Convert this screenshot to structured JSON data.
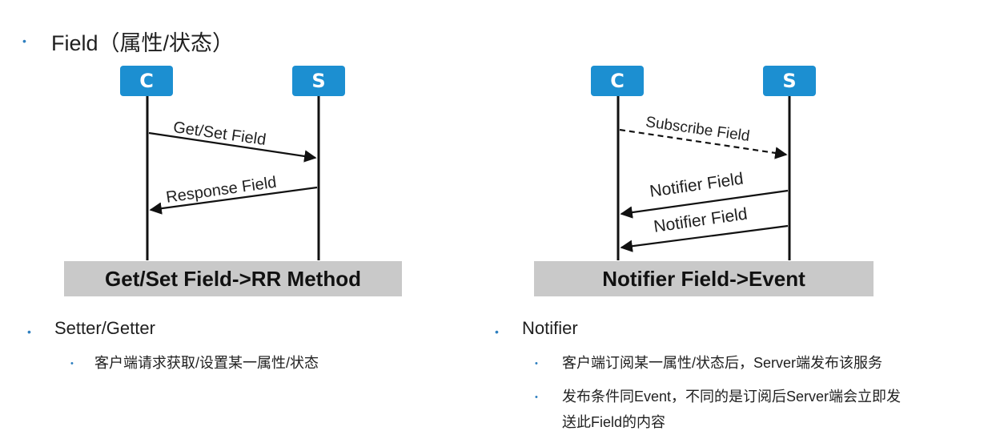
{
  "header": {
    "bullet": "•",
    "title": "Field（属性/状态）"
  },
  "left_diagram": {
    "client_label": "C",
    "server_label": "S",
    "msg1": "Get/Set Field",
    "msg2": "Response Field",
    "caption": "Get/Set Field->RR Method"
  },
  "right_diagram": {
    "client_label": "C",
    "server_label": "S",
    "msg1": "Subscribe Field",
    "msg2": "Notifier Field",
    "msg3": "Notifier Field",
    "caption": "Notifier Field->Event"
  },
  "left_notes": {
    "heading": "Setter/Getter",
    "items": [
      "客户端请求获取/设置某一属性/状态"
    ]
  },
  "right_notes": {
    "heading": "Notifier",
    "items": [
      "客户端订阅某一属性/状态后，Server端发布该服务",
      "发布条件同Event，不同的是订阅后Server端会立即发",
      "送此Field的内容"
    ]
  }
}
